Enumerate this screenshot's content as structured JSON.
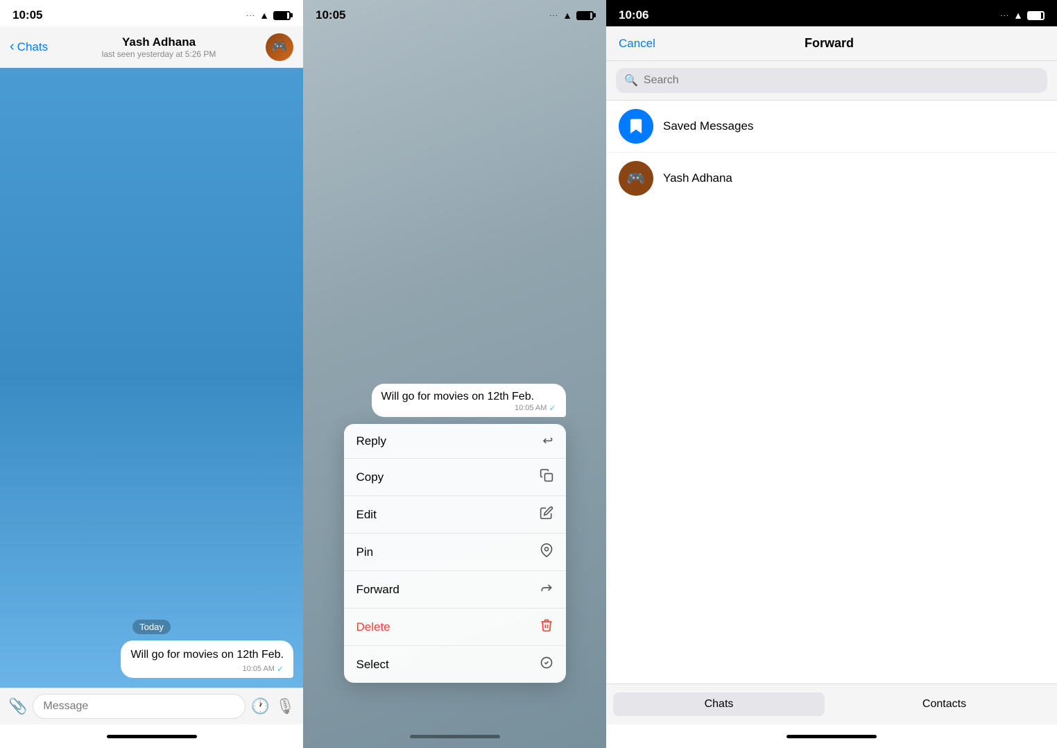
{
  "panel1": {
    "statusBar": {
      "time": "10:05",
      "signal": "···",
      "wifi": "WiFi",
      "battery": "Battery"
    },
    "header": {
      "backLabel": "Chats",
      "contactName": "Yash Adhana",
      "statusText": "last seen yesterday at 5:26 PM"
    },
    "dateBadge": "Today",
    "message": {
      "text": "Will go for movies on 12th Feb.",
      "time": "10:05 AM",
      "checkmark": "✓"
    },
    "inputBar": {
      "placeholder": "Message",
      "attachIcon": "📎",
      "emojiIcon": "🕐",
      "micIcon": "🎙"
    }
  },
  "panel2": {
    "statusBar": {
      "time": "10:05",
      "signal": "···"
    },
    "previewBubble": {
      "text": "Will go for movies on 12th Feb.",
      "time": "10:05 AM",
      "checkmark": "✓"
    },
    "contextMenu": {
      "items": [
        {
          "label": "Reply",
          "icon": "↩"
        },
        {
          "label": "Copy",
          "icon": "⎘"
        },
        {
          "label": "Edit",
          "icon": "✏"
        },
        {
          "label": "Pin",
          "icon": "📌"
        },
        {
          "label": "Forward",
          "icon": "↪"
        },
        {
          "label": "Delete",
          "icon": "🗑",
          "isDelete": true
        },
        {
          "label": "Select",
          "icon": "✓"
        }
      ]
    }
  },
  "panel3": {
    "statusBar": {
      "time": "10:06",
      "signal": "···"
    },
    "header": {
      "cancelLabel": "Cancel",
      "forwardTitle": "Forward"
    },
    "search": {
      "placeholder": "Search",
      "icon": "🔍"
    },
    "contacts": [
      {
        "name": "Saved Messages",
        "type": "saved"
      },
      {
        "name": "Yash Adhana",
        "type": "yash"
      }
    ],
    "bottomTabs": [
      {
        "label": "Chats",
        "active": true
      },
      {
        "label": "Contacts",
        "active": false
      }
    ]
  }
}
